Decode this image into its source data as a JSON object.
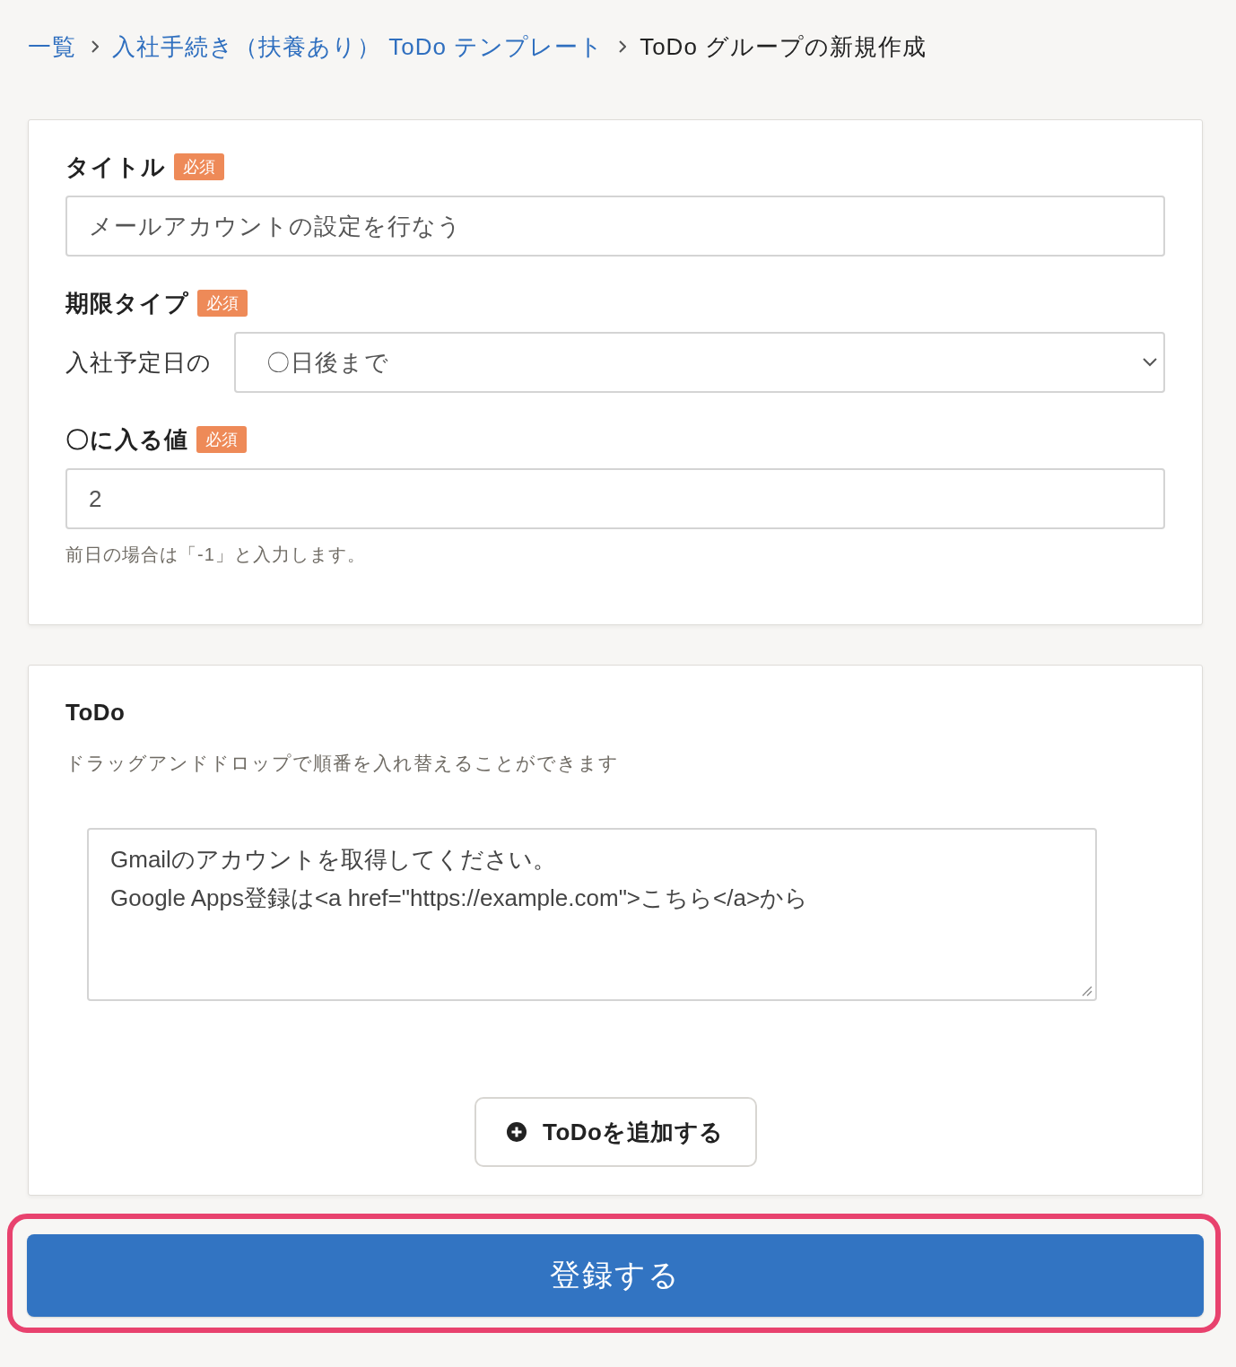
{
  "breadcrumb": [
    {
      "kind": "link",
      "label": "一覧"
    },
    {
      "kind": "link",
      "label": "入社手続き（扶養あり） ToDo テンプレート"
    },
    {
      "kind": "current",
      "label": "ToDo グループの新規作成"
    }
  ],
  "settings_card": {
    "fields": [
      {
        "kind": "text",
        "label": "タイトル",
        "badge": "必須",
        "value": "メールアカウントの設定を行なう"
      },
      {
        "kind": "select",
        "label": "期限タイプ",
        "badge": "必須",
        "prefix": "入社予定日の",
        "value": "〇日後まで"
      },
      {
        "kind": "text",
        "label": "〇に入る値",
        "badge": "必須",
        "value": "2",
        "help": "前日の場合は「-1」と入力します。"
      }
    ]
  },
  "todo_card": {
    "title": "ToDo",
    "description": "ドラッグアンドドロップで順番を入れ替えることができます",
    "items": [
      {
        "value": "Gmailのアカウントを取得してください。\nGoogle Apps登録は<a href=\"https://example.com\">こちら</a>から"
      }
    ],
    "add_button": "ToDoを追加する"
  },
  "submit_button": {
    "label": "登録する",
    "highlighted": true
  }
}
